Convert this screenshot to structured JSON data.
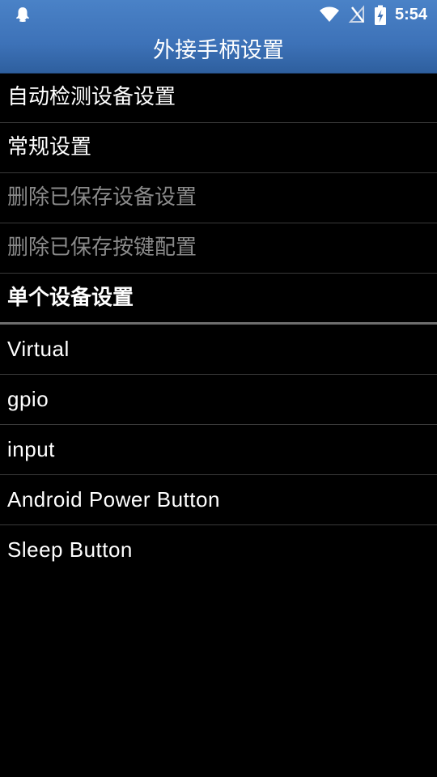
{
  "status_bar": {
    "time": "5:54",
    "icons": [
      "notification-icon",
      "wifi-icon",
      "no-sim-icon",
      "battery-charging-icon"
    ]
  },
  "header": {
    "title": "外接手柄设置"
  },
  "menu": {
    "items": [
      {
        "label": "自动检测设备设置",
        "enabled": true
      },
      {
        "label": "常规设置",
        "enabled": true
      },
      {
        "label": "删除已保存设备设置",
        "enabled": false
      },
      {
        "label": "删除已保存按键配置",
        "enabled": false
      }
    ]
  },
  "section": {
    "title": "单个设备设置"
  },
  "devices": {
    "items": [
      {
        "label": "Virtual"
      },
      {
        "label": "gpio"
      },
      {
        "label": "input"
      },
      {
        "label": "Android Power Button"
      },
      {
        "label": "Sleep Button"
      }
    ]
  },
  "colors": {
    "header_bg": "#4a82c7",
    "background": "#000000",
    "text": "#ffffff",
    "disabled_text": "#8a8a8a",
    "divider": "#3a3a3a"
  }
}
